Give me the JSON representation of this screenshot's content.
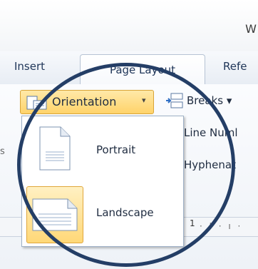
{
  "window": {
    "title_fragment": "W"
  },
  "tabs": [
    {
      "label": "Insert"
    },
    {
      "label": "Page Layout"
    },
    {
      "label": "Refe"
    }
  ],
  "ribbon": {
    "orientation_label": "Orientation",
    "breaks_label": "Breaks",
    "line_numbers_label": "Line Numl",
    "hyphenation_label": "Hyphenat",
    "left_edge_fragment": "s",
    "ruler_number": "1"
  },
  "orientation_menu": {
    "items": [
      {
        "label": "Portrait",
        "icon": "portrait-page-icon",
        "selected": false
      },
      {
        "label": "Landscape",
        "icon": "landscape-page-icon",
        "selected": true
      }
    ]
  },
  "colors": {
    "highlight": "#ffd36a",
    "annotation_circle": "#243e66"
  }
}
